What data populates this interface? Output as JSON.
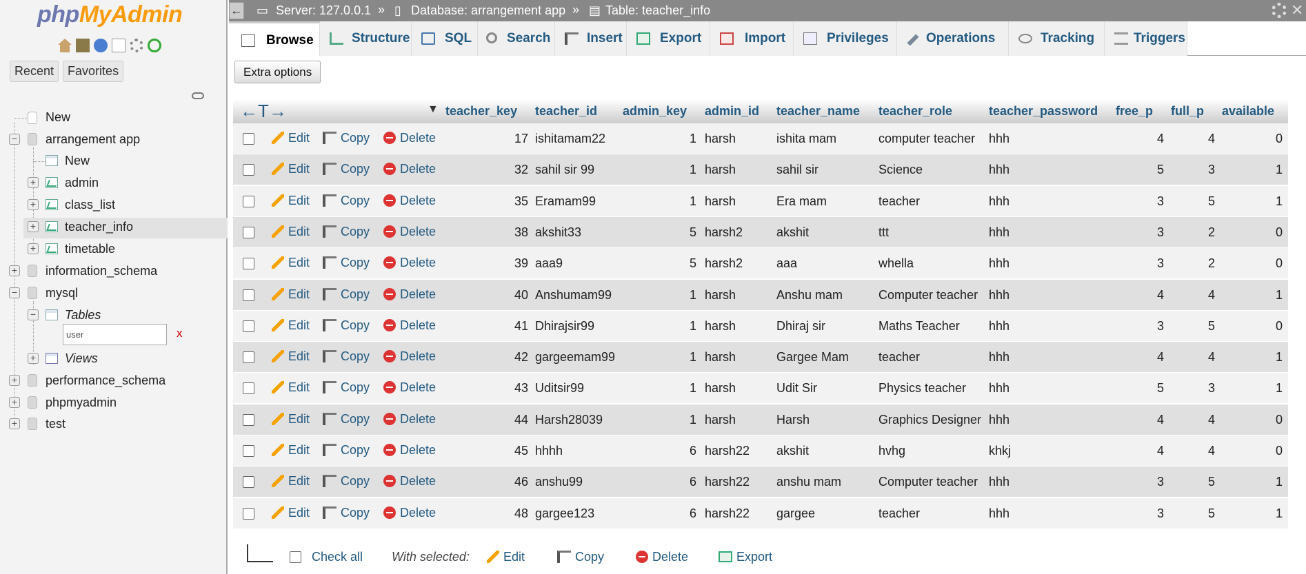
{
  "logo": {
    "php": "php",
    "my": "My",
    "admin": "Admin"
  },
  "nav": {
    "recent": "Recent",
    "favorites": "Favorites",
    "new_top": "New",
    "db_arrangement": "arrangement app",
    "new_sub": "New",
    "tables": [
      "admin",
      "class_list",
      "teacher_info",
      "timetable"
    ],
    "db_information": "information_schema",
    "db_mysql": "mysql",
    "mysql_tables": "Tables",
    "filter_value": "user",
    "filter_clear": "x",
    "mysql_views": "Views",
    "db_performance": "performance_schema",
    "db_phpmyadmin": "phpmyadmin",
    "db_test": "test"
  },
  "breadcrumb": {
    "server": "Server: 127.0.0.1",
    "database": "Database: arrangement app",
    "table": "Table: teacher_info",
    "sep": "»"
  },
  "tabs": [
    "Browse",
    "Structure",
    "SQL",
    "Search",
    "Insert",
    "Export",
    "Import",
    "Privileges",
    "Operations",
    "Tracking",
    "Triggers"
  ],
  "extra_options": "Extra options",
  "columns": [
    "teacher_key",
    "teacher_id",
    "admin_key",
    "admin_id",
    "teacher_name",
    "teacher_role",
    "teacher_password",
    "free_p",
    "full_p",
    "available"
  ],
  "actions": {
    "edit": "Edit",
    "copy": "Copy",
    "delete": "Delete"
  },
  "rows": [
    [
      "17",
      "ishitamam22",
      "1",
      "harsh",
      "ishita mam",
      "computer teacher",
      "hhh",
      "4",
      "4",
      "0"
    ],
    [
      "32",
      "sahil sir 99",
      "1",
      "harsh",
      "sahil sir",
      "Science",
      "hhh",
      "5",
      "3",
      "1"
    ],
    [
      "35",
      "Eramam99",
      "1",
      "harsh",
      "Era mam",
      "teacher",
      "hhh",
      "3",
      "5",
      "1"
    ],
    [
      "38",
      "akshit33",
      "5",
      "harsh2",
      "akshit",
      "ttt",
      "hhh",
      "3",
      "2",
      "0"
    ],
    [
      "39",
      "aaa9",
      "5",
      "harsh2",
      "aaa",
      "whella",
      "hhh",
      "3",
      "2",
      "0"
    ],
    [
      "40",
      "Anshumam99",
      "1",
      "harsh",
      "Anshu mam",
      "Computer teacher",
      "hhh",
      "4",
      "4",
      "1"
    ],
    [
      "41",
      "Dhirajsir99",
      "1",
      "harsh",
      "Dhiraj sir",
      "Maths Teacher",
      "hhh",
      "3",
      "5",
      "0"
    ],
    [
      "42",
      "gargeemam99",
      "1",
      "harsh",
      "Gargee Mam",
      "teacher",
      "hhh",
      "4",
      "4",
      "1"
    ],
    [
      "43",
      "Uditsir99",
      "1",
      "harsh",
      "Udit Sir",
      "Physics teacher",
      "hhh",
      "5",
      "3",
      "1"
    ],
    [
      "44",
      "Harsh28039",
      "1",
      "harsh",
      "Harsh",
      "Graphics Designer",
      "hhh",
      "4",
      "4",
      "0"
    ],
    [
      "45",
      "hhhh",
      "6",
      "harsh22",
      "akshit",
      "hvhg",
      "khkj",
      "4",
      "4",
      "0"
    ],
    [
      "46",
      "anshu99",
      "6",
      "harsh22",
      "anshu mam",
      "Computer teacher",
      "hhh",
      "3",
      "5",
      "1"
    ],
    [
      "48",
      "gargee123",
      "6",
      "harsh22",
      "gargee",
      "teacher",
      "hhh",
      "3",
      "5",
      "1"
    ]
  ],
  "footer": {
    "check_all": "Check all",
    "with_selected": "With selected:",
    "edit": "Edit",
    "copy": "Copy",
    "delete": "Delete",
    "export": "Export"
  },
  "colors": {
    "link": "#235a81",
    "header_bg": "#888888",
    "accent_orange": "#f89c0e",
    "accent_php": "#6c78af"
  }
}
